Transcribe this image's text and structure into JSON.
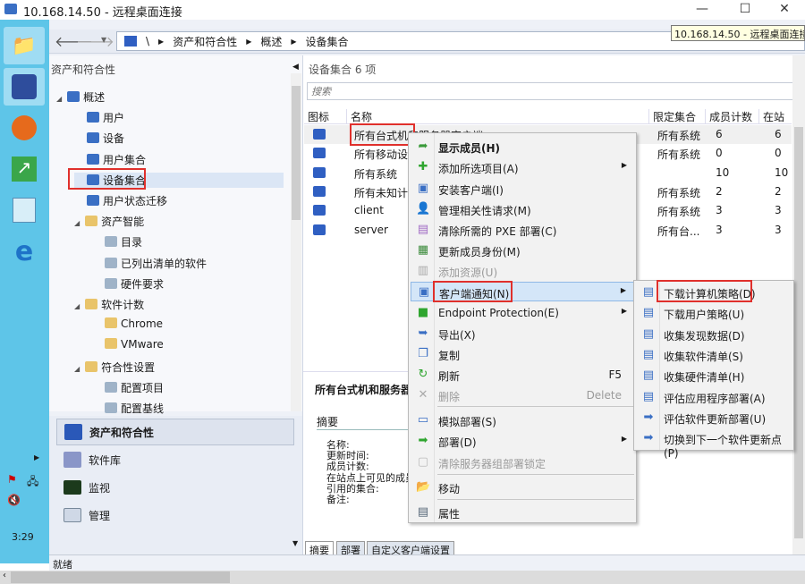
{
  "window": {
    "title": "10.168.14.50 - 远程桌面连接",
    "tooltip": "10.168.14.50 - 远程桌面连接",
    "minimize": "—",
    "maximize": "☐",
    "close": "✕"
  },
  "taskbar": {
    "clock": "3:29"
  },
  "breadcrumb": [
    "\\",
    "资产和符合性",
    "概述",
    "设备集合"
  ],
  "nav": {
    "title": "资产和符合性",
    "tree": [
      {
        "label": "概述",
        "level": 0
      },
      {
        "label": "用户",
        "level": 1
      },
      {
        "label": "设备",
        "level": 1
      },
      {
        "label": "用户集合",
        "level": 1
      },
      {
        "label": "设备集合",
        "level": 1,
        "selected": true
      },
      {
        "label": "用户状态迁移",
        "level": 1
      },
      {
        "label": "资产智能",
        "level": 1
      },
      {
        "label": "目录",
        "level": 2
      },
      {
        "label": "已列出清单的软件",
        "level": 2
      },
      {
        "label": "硬件要求",
        "level": 2
      },
      {
        "label": "软件计数",
        "level": 1
      },
      {
        "label": "Chrome",
        "level": 2
      },
      {
        "label": "VMware",
        "level": 2
      },
      {
        "label": "符合性设置",
        "level": 1
      },
      {
        "label": "配置项目",
        "level": 2
      },
      {
        "label": "配置基线",
        "level": 2
      }
    ],
    "workspaces": [
      "资产和符合性",
      "软件库",
      "监视",
      "管理"
    ]
  },
  "main": {
    "header": "设备集合 6 项",
    "search_placeholder": "搜索",
    "columns": [
      "图标",
      "名称",
      "限定集合",
      "成员计数",
      "在站"
    ],
    "rows": [
      [
        "所有台式机和服务器客户端",
        "所有系统",
        "6",
        "6"
      ],
      [
        "所有移动设备",
        "所有系统",
        "0",
        "0"
      ],
      [
        "所有系统",
        "",
        "10",
        "10"
      ],
      [
        "所有未知计算机",
        "所有系统",
        "2",
        "2"
      ],
      [
        "client",
        "所有系统",
        "3",
        "3"
      ],
      [
        "server",
        "所有台...",
        "3",
        "3"
      ]
    ],
    "details": {
      "title": "所有台式机和服务器客户端",
      "section": "摘要",
      "fields": [
        "名称:",
        "更新时间:",
        "成员计数:",
        "在站点上可见的成员计数:",
        "引用的集合:",
        "备注:"
      ]
    },
    "tabs": [
      "摘要",
      "部署",
      "自定义客户端设置"
    ]
  },
  "context_menu": [
    {
      "label": "显示成员(H)",
      "icon": "arrow-icon",
      "bold": true
    },
    {
      "label": "添加所选项目(A)",
      "icon": "plus-icon",
      "submenu": true
    },
    {
      "label": "安装客户端(I)",
      "icon": "install-icon"
    },
    {
      "label": "管理相关性请求(M)",
      "icon": "user-icon"
    },
    {
      "label": "清除所需的 PXE 部署(C)",
      "icon": "pxe-icon"
    },
    {
      "label": "更新成员身份(M)",
      "icon": "update-icon"
    },
    {
      "label": "添加资源(U)",
      "icon": "add-resource-icon",
      "disabled": true
    },
    {
      "label": "客户端通知(N)",
      "icon": "notify-icon",
      "submenu": true,
      "highlighted": true
    },
    {
      "label": "Endpoint Protection(E)",
      "icon": "shield-icon",
      "submenu": true
    },
    {
      "label": "导出(X)",
      "icon": "export-icon"
    },
    {
      "label": "复制",
      "icon": "copy-icon"
    },
    {
      "label": "刷新",
      "icon": "refresh-icon",
      "shortcut": "F5"
    },
    {
      "label": "删除",
      "icon": "delete-icon",
      "shortcut": "Delete",
      "disabled": true
    },
    {
      "label": "模拟部署(S)",
      "icon": "simulate-icon"
    },
    {
      "label": "部署(D)",
      "icon": "deploy-icon",
      "submenu": true
    },
    {
      "label": "清除服务器组部署锁定",
      "icon": "lock-icon",
      "disabled": true
    },
    {
      "label": "移动",
      "icon": "folder-icon"
    },
    {
      "label": "属性",
      "icon": "properties-icon"
    }
  ],
  "submenu": [
    "下载计算机策略(D)",
    "下载用户策略(U)",
    "收集发现数据(D)",
    "收集软件清单(S)",
    "收集硬件清单(H)",
    "评估应用程序部署(A)",
    "评估软件更新部署(U)",
    "切换到下一个软件更新点(P)"
  ],
  "status": "就绪"
}
